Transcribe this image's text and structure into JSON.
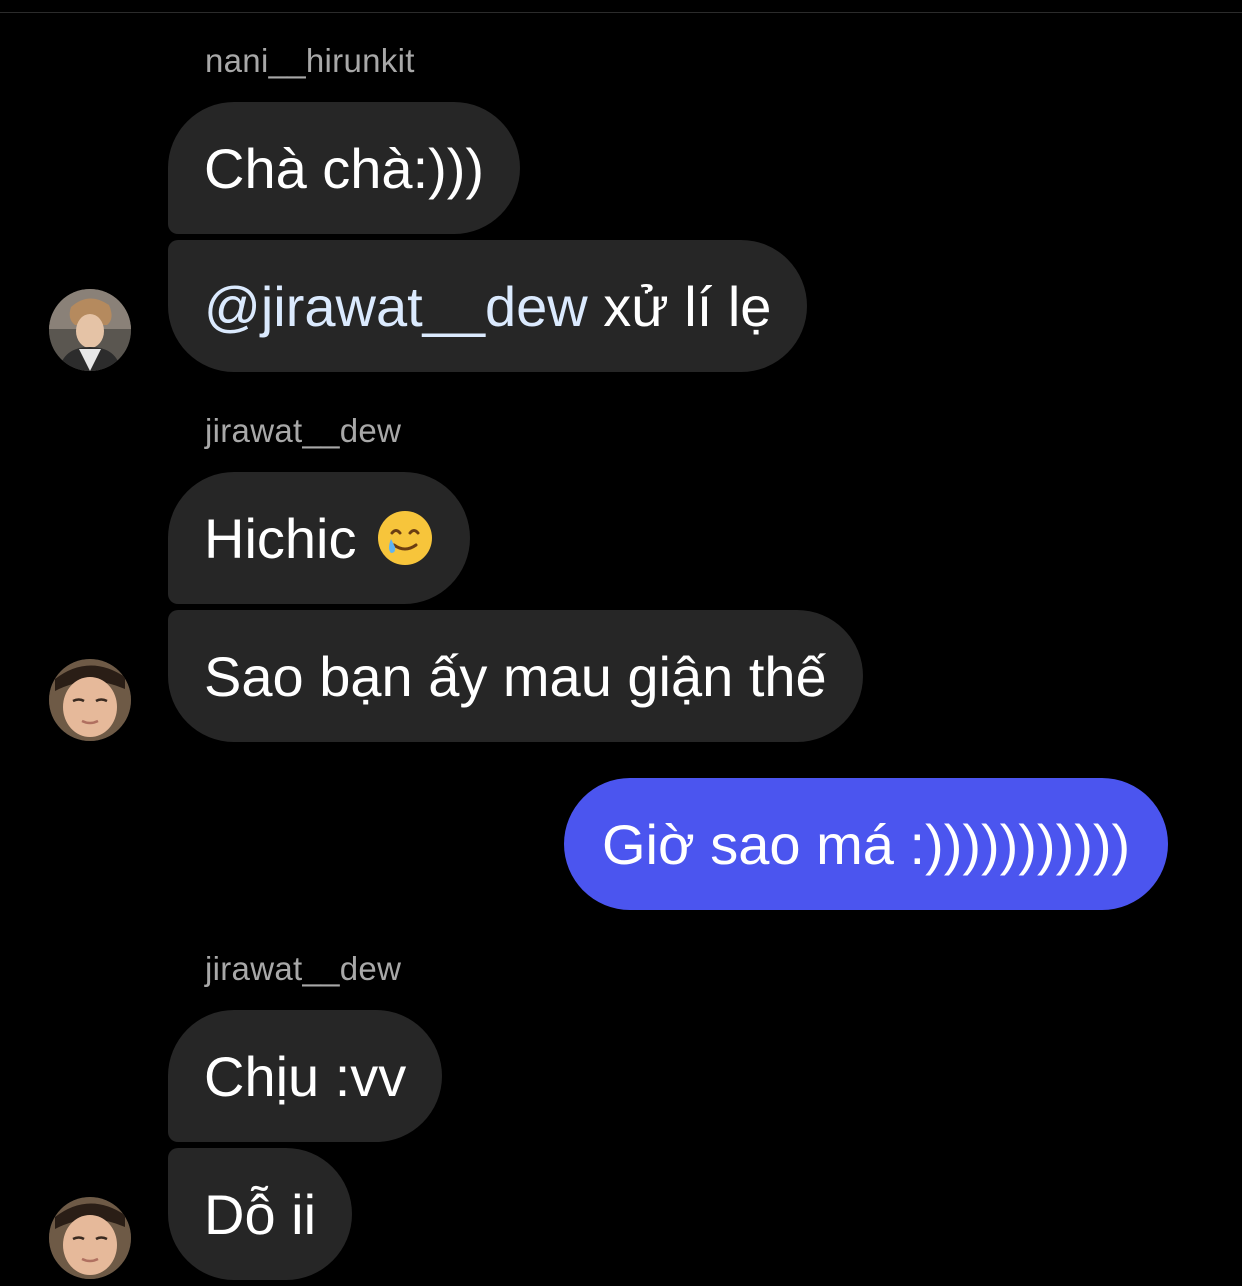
{
  "thread": {
    "groups": [
      {
        "sender": "nani__hirunkit",
        "messages": [
          {
            "text": "Chà chà:)))"
          },
          {
            "mention": "@jirawat__dew",
            "text": " xử lí lẹ"
          }
        ],
        "avatar_icon": "user-avatar-nani"
      },
      {
        "sender": "jirawat__dew",
        "messages": [
          {
            "text": "Hichic",
            "emoji": "smiling-face-with-tear-icon"
          },
          {
            "text": "Sao bạn ấy mau giận thế"
          }
        ],
        "avatar_icon": "user-avatar-jirawat"
      },
      {
        "outgoing": true,
        "messages": [
          {
            "text": "Giờ sao má :)))))))))))"
          }
        ]
      },
      {
        "sender": "jirawat__dew",
        "messages": [
          {
            "text": "Chịu :vv"
          },
          {
            "text": "Dỗ ii"
          }
        ],
        "avatar_icon": "user-avatar-jirawat"
      }
    ]
  },
  "colors": {
    "background": "#000000",
    "incoming_bubble": "#262626",
    "outgoing_bubble": "#4b55ef",
    "sender_name": "#a8a8a8",
    "mention": "#dbeafe"
  }
}
